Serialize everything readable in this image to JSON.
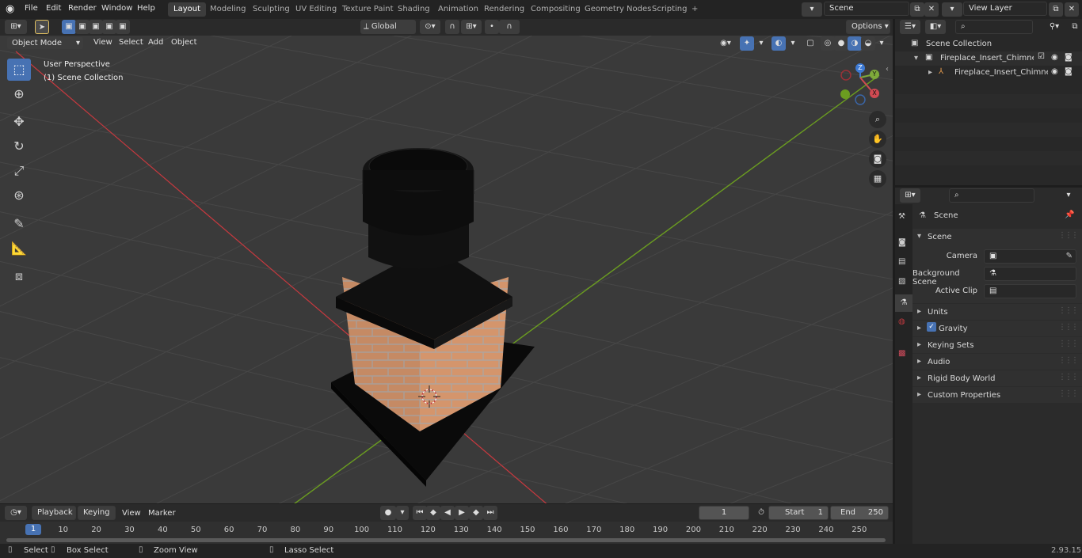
{
  "app": {
    "version": "2.93.15"
  },
  "menu": [
    "File",
    "Edit",
    "Render",
    "Window",
    "Help"
  ],
  "workspaces": [
    "Layout",
    "Modeling",
    "Sculpting",
    "UV Editing",
    "Texture Paint",
    "Shading",
    "Animation",
    "Rendering",
    "Compositing",
    "Geometry Nodes",
    "Scripting"
  ],
  "active_workspace": "Layout",
  "scene_field": "Scene",
  "view_layer_field": "View Layer",
  "viewport_header": {
    "mode": "Object Mode",
    "menus": [
      "View",
      "Select",
      "Add",
      "Object"
    ],
    "orientation": "Global",
    "options": "Options"
  },
  "viewport": {
    "perspective": "User Perspective",
    "collection": "(1) Scene Collection"
  },
  "gizmo": {
    "z": "Z",
    "y": "Y",
    "x": "X"
  },
  "outliner": {
    "root": "Scene Collection",
    "items": [
      {
        "label": "Fireplace_Insert_Chimney_Bri"
      },
      {
        "label": "Fireplace_Insert_Chimney"
      }
    ]
  },
  "properties": {
    "header": "Scene",
    "section": "Scene",
    "fields": [
      {
        "label": "Camera"
      },
      {
        "label": "Background Scene"
      },
      {
        "label": "Active Clip"
      }
    ],
    "panels": [
      "Units",
      "Gravity",
      "Keying Sets",
      "Audio",
      "Rigid Body World",
      "Custom Properties"
    ]
  },
  "timeline_header": {
    "menus": [
      "Playback",
      "Keying",
      "View",
      "Marker"
    ],
    "current_frame": "1",
    "start_label": "Start",
    "start": "1",
    "end_label": "End",
    "end": "250"
  },
  "timeline_ticks": [
    "1",
    "10",
    "20",
    "30",
    "40",
    "50",
    "60",
    "70",
    "80",
    "90",
    "100",
    "110",
    "120",
    "130",
    "140",
    "150",
    "160",
    "170",
    "180",
    "190",
    "200",
    "210",
    "220",
    "230",
    "240",
    "250"
  ],
  "statusbar": {
    "select": "Select",
    "box_select": "Box Select",
    "zoom_view": "Zoom View",
    "lasso_select": "Lasso Select"
  },
  "colors": {
    "accent": "#4772b3",
    "x_axis": "#c8393f",
    "y_axis": "#6b9d20",
    "brick": "#c58a64",
    "chimney": "#0e0e0e"
  }
}
